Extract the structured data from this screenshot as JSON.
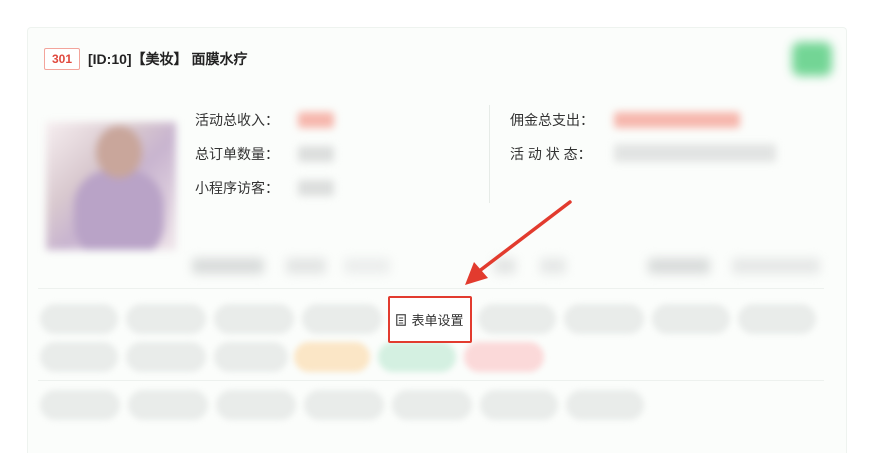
{
  "header": {
    "badge": "301",
    "title": "[ID:10]【美妆】 面膜水疗"
  },
  "stats": {
    "revenue_label": "活动总收入：",
    "orders_label": "总订单数量：",
    "visitors_label": "小程序访客：",
    "commission_label": "佣金总支出：",
    "status_label": "活 动 状 态："
  },
  "actions": {
    "form_settings_label": "表单设置"
  },
  "colors": {
    "accent_red": "#e23b2e",
    "badge_red": "#e0483d",
    "corner_green": "#5ccf84"
  },
  "icons": {
    "form_settings": "document-icon",
    "corner": "status-icon"
  }
}
